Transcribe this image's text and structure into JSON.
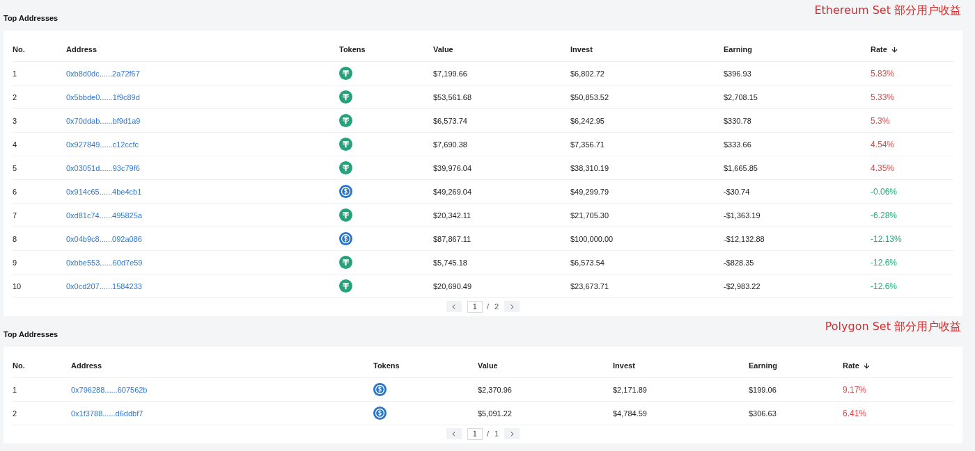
{
  "sections": [
    {
      "title": "Top Addresses",
      "annotation": "Ethereum Set 部分用户收益",
      "columns": [
        {
          "label": "No.",
          "sorted": false
        },
        {
          "label": "Address",
          "sorted": false
        },
        {
          "label": "Tokens",
          "sorted": false
        },
        {
          "label": "Value",
          "sorted": false
        },
        {
          "label": "Invest",
          "sorted": false
        },
        {
          "label": "Earning",
          "sorted": false
        },
        {
          "label": "Rate",
          "sorted": true
        }
      ],
      "rows": [
        {
          "no": "1",
          "address": "0xb8d0dc......2a72f67",
          "kind": "tether",
          "value": "$7,199.66",
          "invest": "$6,802.72",
          "earning": "$396.93",
          "rate": "5.83%",
          "color": "#e8484a"
        },
        {
          "no": "2",
          "address": "0x5bbde0......1f9c89d",
          "kind": "tether",
          "value": "$53,561.68",
          "invest": "$50,853.52",
          "earning": "$2,708.15",
          "rate": "5.33%",
          "color": "#e8484a"
        },
        {
          "no": "3",
          "address": "0x70ddab......bf9d1a9",
          "kind": "tether",
          "value": "$6,573.74",
          "invest": "$6,242.95",
          "earning": "$330.78",
          "rate": "5.3%",
          "color": "#e8484a"
        },
        {
          "no": "4",
          "address": "0x927849......c12ccfc",
          "kind": "tether",
          "value": "$7,690.38",
          "invest": "$7,356.71",
          "earning": "$333.66",
          "rate": "4.54%",
          "color": "#e8484a"
        },
        {
          "no": "5",
          "address": "0x03051d......93c79f6",
          "kind": "tether",
          "value": "$39,976.04",
          "invest": "$38,310.19",
          "earning": "$1,665.85",
          "rate": "4.35%",
          "color": "#e8484a"
        },
        {
          "no": "6",
          "address": "0x914c65......4be4cb1",
          "kind": "usdc",
          "value": "$49,269.04",
          "invest": "$49,299.79",
          "earning": "-$30.74",
          "rate": "-0.06%",
          "color": "#1fae80"
        },
        {
          "no": "7",
          "address": "0xd81c74......495825a",
          "kind": "tether",
          "value": "$20,342.11",
          "invest": "$21,705.30",
          "earning": "-$1,363.19",
          "rate": "-6.28%",
          "color": "#1fae80"
        },
        {
          "no": "8",
          "address": "0x04b9c8......092a086",
          "kind": "usdc",
          "value": "$87,867.11",
          "invest": "$100,000.00",
          "earning": "-$12,132.88",
          "rate": "-12.13%",
          "color": "#1fae80"
        },
        {
          "no": "9",
          "address": "0xbbe553......60d7e59",
          "kind": "tether",
          "value": "$5,745.18",
          "invest": "$6,573.54",
          "earning": "-$828.35",
          "rate": "-12.6%",
          "color": "#1fae80"
        },
        {
          "no": "10",
          "address": "0x0cd207......1584233",
          "kind": "tether",
          "value": "$20,690.49",
          "invest": "$23,673.71",
          "earning": "-$2,983.22",
          "rate": "-12.6%",
          "color": "#1fae80"
        }
      ],
      "pagination": {
        "page": "1",
        "separator": "/",
        "total": "2"
      }
    },
    {
      "title": "Top Addresses",
      "annotation": "Polygon Set 部分用户收益",
      "columns": [
        {
          "label": "No.",
          "sorted": false
        },
        {
          "label": "Address",
          "sorted": false
        },
        {
          "label": "Tokens",
          "sorted": false
        },
        {
          "label": "Value",
          "sorted": false
        },
        {
          "label": "Invest",
          "sorted": false
        },
        {
          "label": "Earning",
          "sorted": false
        },
        {
          "label": "Rate",
          "sorted": true
        }
      ],
      "rows": [
        {
          "no": "1",
          "address": "0x796288......607562b",
          "kind": "usdc",
          "value": "$2,370.96",
          "invest": "$2,171.89",
          "earning": "$199.06",
          "rate": "9.17%",
          "color": "#e8484a"
        },
        {
          "no": "2",
          "address": "0x1f3788......d6ddbf7",
          "kind": "usdc",
          "value": "$5,091.22",
          "invest": "$4,784.59",
          "earning": "$306.63",
          "rate": "6.41%",
          "color": "#e8484a"
        }
      ],
      "pagination": {
        "page": "1",
        "separator": "/",
        "total": "1"
      }
    }
  ]
}
